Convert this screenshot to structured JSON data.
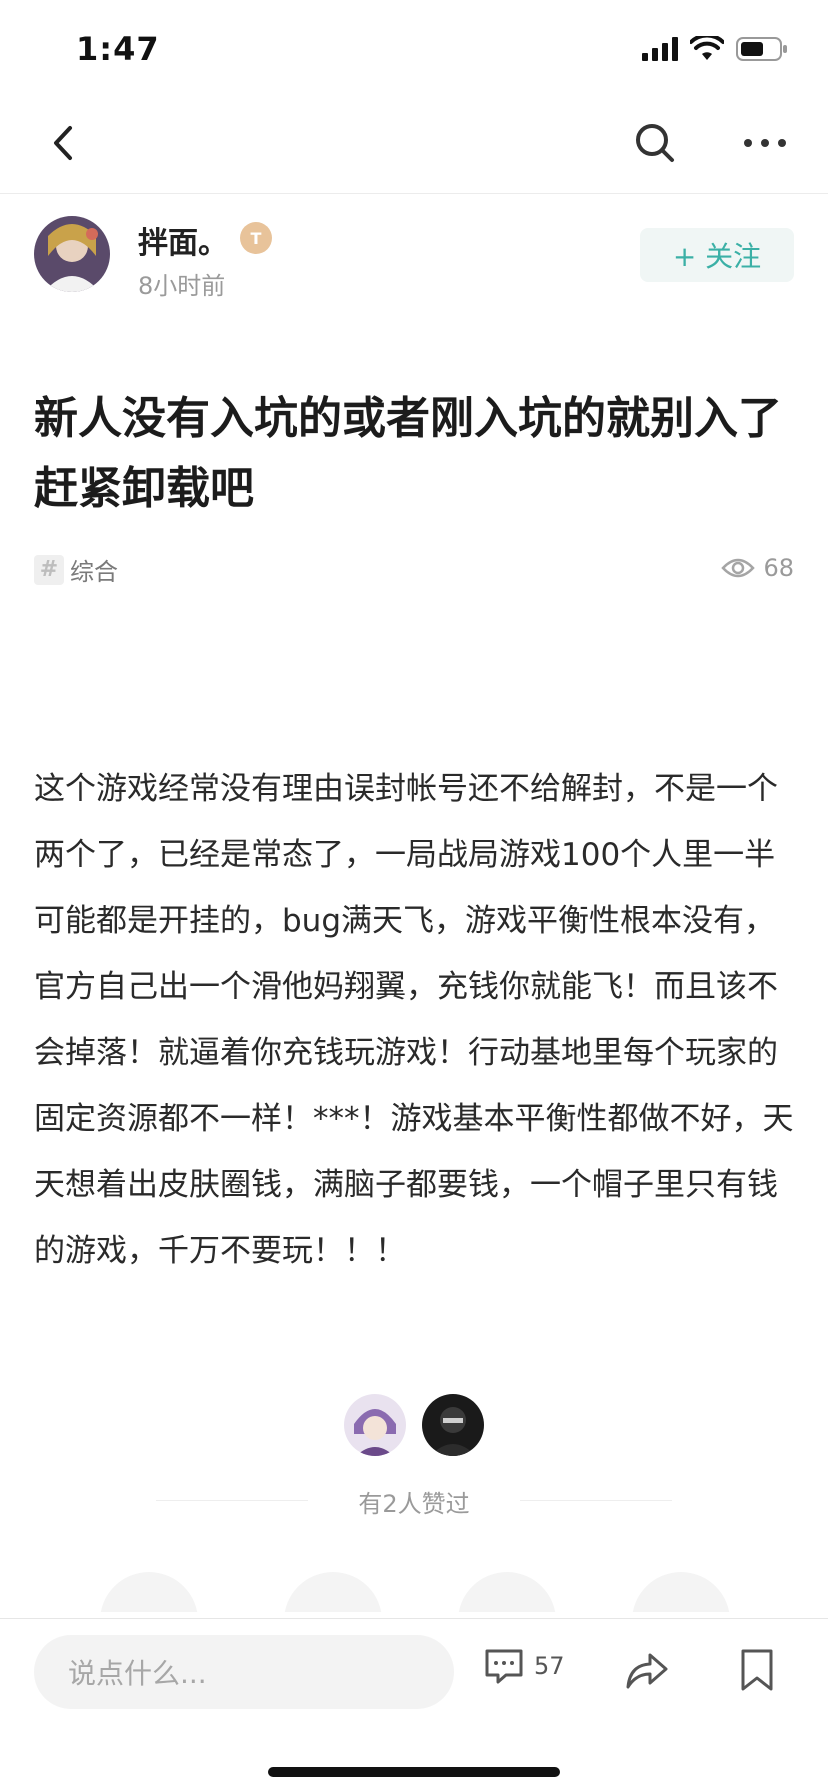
{
  "status": {
    "time": "1:47"
  },
  "author": {
    "name": "拌面。",
    "badge": "T",
    "time": "8小时前",
    "follow_label": "+ 关注"
  },
  "post": {
    "title": "新人没有入坑的或者刚入坑的就别入了赶紧卸载吧",
    "topic": "综合",
    "views": "68",
    "body": "这个游戏经常没有理由误封帐号还不给解封，不是一个两个了，已经是常态了，一局战局游戏100个人里一半可能都是开挂的，bug满天飞，游戏平衡性根本没有，官方自己出一个滑他妈翔翼，充钱你就能飞！而且该不会掉落！就逼着你充钱玩游戏！行动基地里每个玩家的固定资源都不一样！***！游戏基本平衡性都做不好，天天想着出皮肤圈钱，满脑子都要钱，一个帽子里只有钱的游戏，千万不要玩！！！"
  },
  "likes": {
    "text": "有2人赞过"
  },
  "bottom_bar": {
    "comment_placeholder": "说点什么...",
    "comment_count": "57"
  },
  "colors": {
    "accent": "#3bb0a6",
    "muted": "#9a9a9a"
  }
}
